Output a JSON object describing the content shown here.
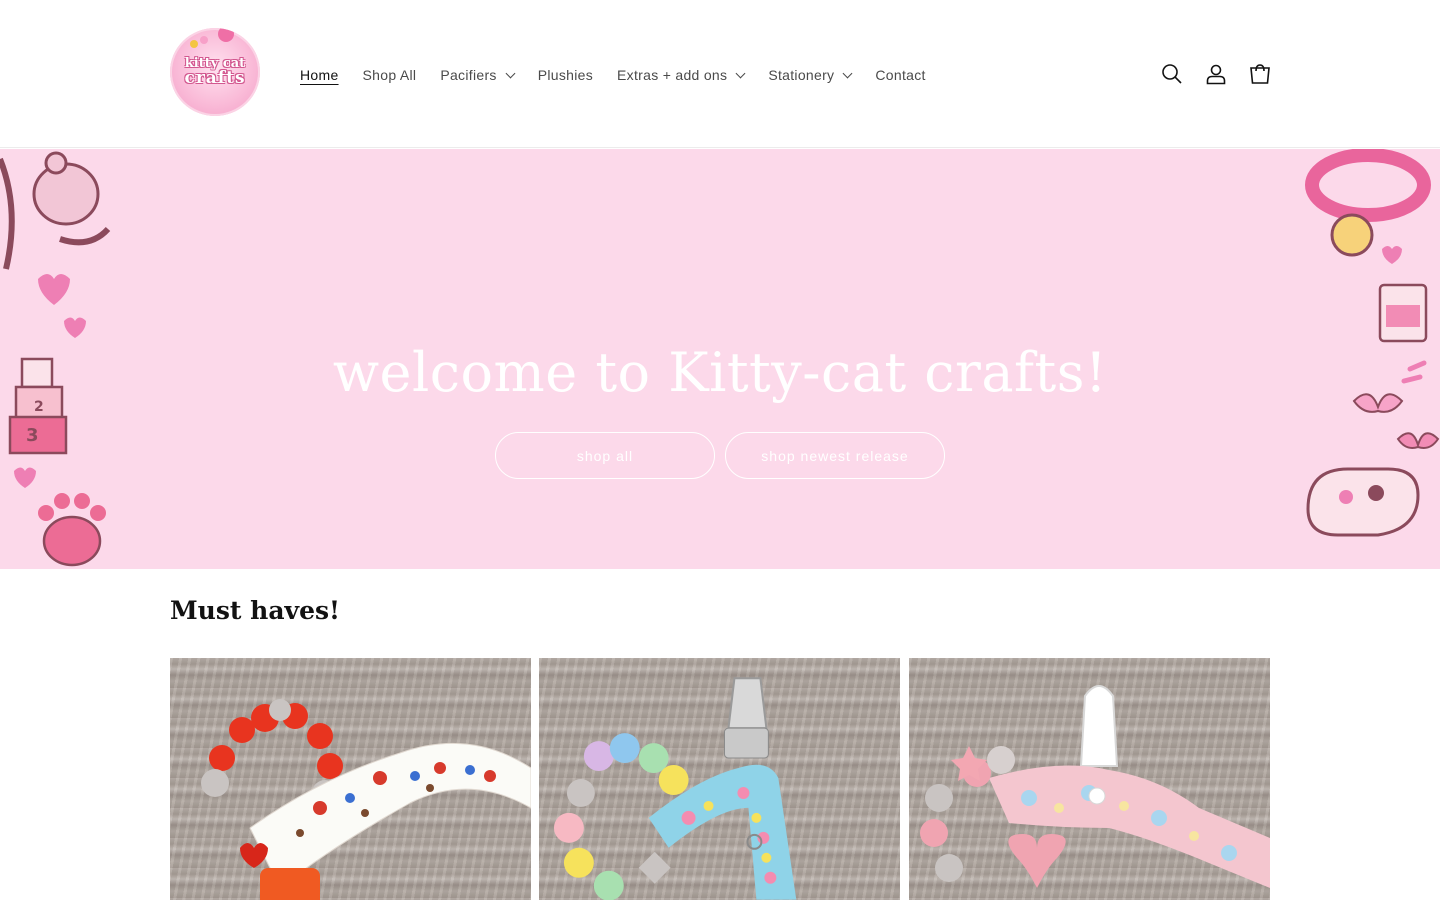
{
  "header": {
    "logo": {
      "line1": "kitty cat",
      "line2": "crafts"
    },
    "nav": [
      {
        "label": "Home",
        "active": true,
        "dropdown": false
      },
      {
        "label": "Shop All",
        "active": false,
        "dropdown": false
      },
      {
        "label": "Pacifiers",
        "active": false,
        "dropdown": true
      },
      {
        "label": "Plushies",
        "active": false,
        "dropdown": false
      },
      {
        "label": "Extras + add ons",
        "active": false,
        "dropdown": true
      },
      {
        "label": "Stationery",
        "active": false,
        "dropdown": true
      },
      {
        "label": "Contact",
        "active": false,
        "dropdown": false
      }
    ],
    "icons": [
      "search-icon",
      "account-icon",
      "cart-icon"
    ]
  },
  "hero": {
    "title": "welcome to Kitty-cat crafts!",
    "buttons": [
      {
        "label": "shop all"
      },
      {
        "label": "shop newest release"
      }
    ],
    "background_color": "#fcd9ea"
  },
  "collection": {
    "title": "Must haves!",
    "products": [
      {
        "name": "red-pacifier-clip",
        "bead_color": "#e8341f",
        "ribbon_color": "#ffffff",
        "clip_color": "#f05a22"
      },
      {
        "name": "pastel-pacifier-clip",
        "bead_color": "#f6c3d2",
        "ribbon_color": "#8fd3e8",
        "clip_color": "#c9c9c9"
      },
      {
        "name": "pink-pacifier-clip",
        "bead_color": "#f0a4b1",
        "ribbon_color": "#f4c6cf",
        "clip_color": "#ffffff"
      }
    ]
  },
  "colors": {
    "accent": "#121212",
    "hero_pink": "#fcd9ea",
    "deco_pink": "#f08fbf",
    "deco_dark": "#8b4a5c"
  }
}
